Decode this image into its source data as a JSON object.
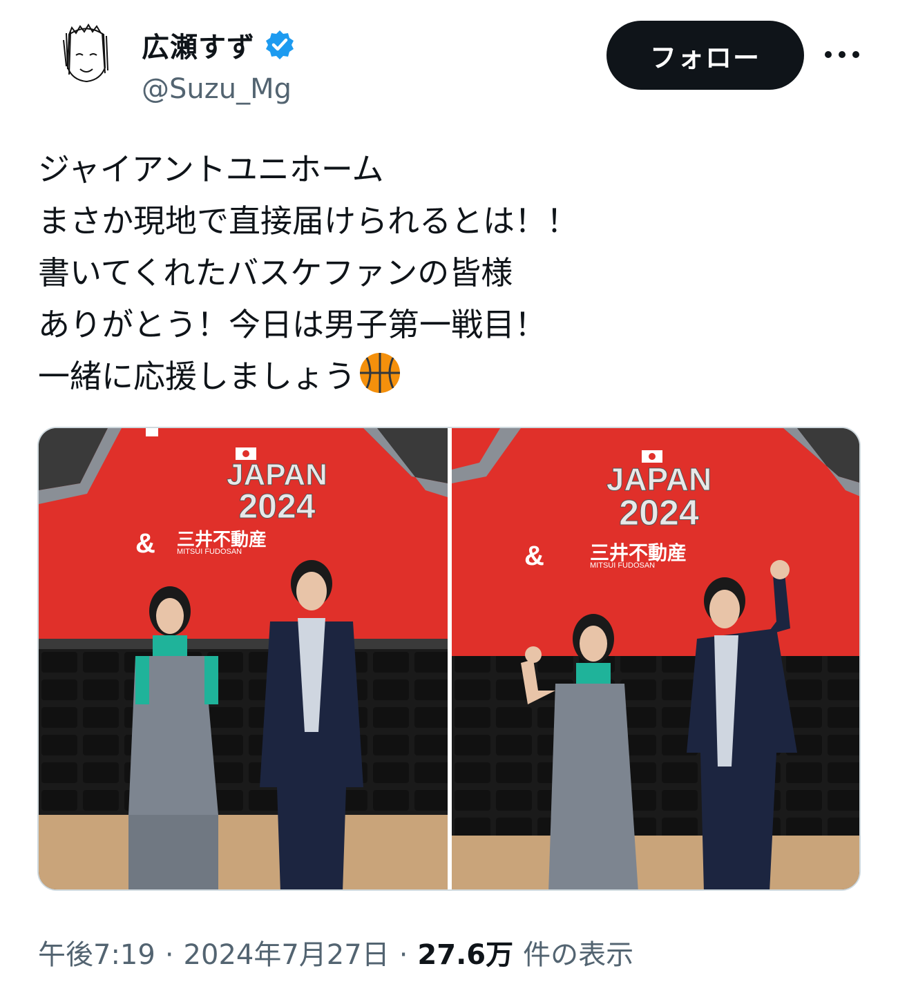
{
  "user": {
    "display_name": "広瀬すず",
    "handle": "@Suzu_Mg",
    "verified": true,
    "avatar_icon": "avatar-drawing-icon",
    "verified_icon": "verified-badge-icon"
  },
  "actions": {
    "follow_label": "フォロー",
    "more_icon": "more-options-icon"
  },
  "tweet": {
    "lines": [
      "ジャイアントユニホーム",
      "まさか現地で直接届けられるとは！！",
      "書いてくれたバスケファンの皆様",
      "ありがとう！今日は男子第一戦目！",
      "一緒に応援しましょう"
    ],
    "emoji_icon": "basketball-icon"
  },
  "media": {
    "photos": [
      {
        "jersey_country": "JAPAN",
        "jersey_year": "2024",
        "sponsor_mark": "&",
        "sponsor_jp": "三井不動産",
        "sponsor_en": "MITSUI FUDOSAN"
      },
      {
        "jersey_country": "JAPAN",
        "jersey_year": "2024",
        "sponsor_mark": "&",
        "sponsor_jp": "三井不動産",
        "sponsor_en": "MITSUI FUDOSAN"
      }
    ]
  },
  "meta": {
    "time": "午後7:19",
    "separator": "·",
    "date": "2024年7月27日",
    "views_count": "27.6万",
    "views_label": "件の表示"
  },
  "colors": {
    "text_primary": "#0f1419",
    "text_secondary": "#536471",
    "verified_blue": "#1d9bf0",
    "jersey_red": "#e0302a",
    "basketball_orange": "#f4900c"
  }
}
